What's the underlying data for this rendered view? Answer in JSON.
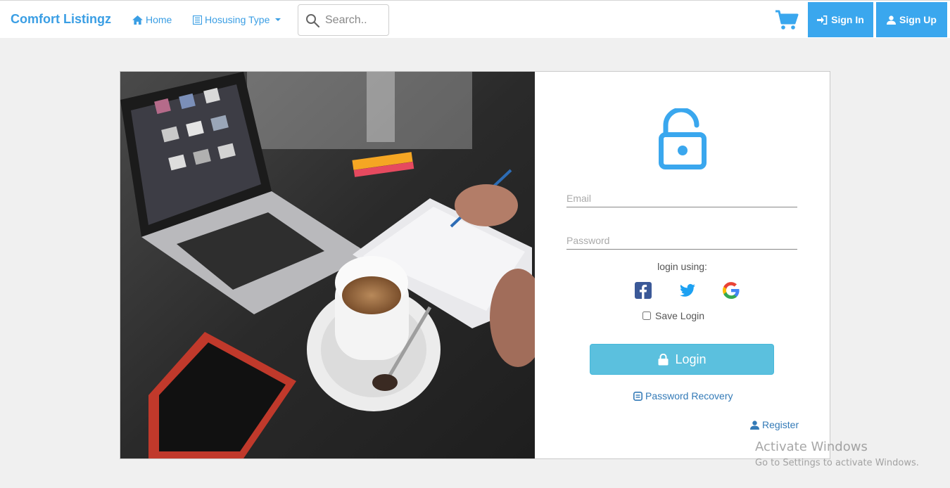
{
  "navbar": {
    "brand": "Comfort Listingz",
    "home_label": "Home",
    "housing_label": "Hosusing Type",
    "search_placeholder": "Search..",
    "signin_label": "Sign In",
    "signup_label": "Sign Up"
  },
  "login": {
    "email_placeholder": "Email",
    "password_placeholder": "Password",
    "login_using": "login using:",
    "social": [
      "facebook-icon",
      "twitter-icon",
      "google-icon"
    ],
    "save_login": "Save Login",
    "save_login_checked": false,
    "login_button": "Login",
    "recovery_link": "Password Recovery",
    "register_link": "Register"
  },
  "watermark": {
    "line1": "Activate Windows",
    "line2": "Go to Settings to activate Windows."
  },
  "colors": {
    "accent": "#3aa7ee",
    "brand": "#3a9ee4",
    "login_button": "#5bc0de",
    "link": "#337ab7"
  }
}
